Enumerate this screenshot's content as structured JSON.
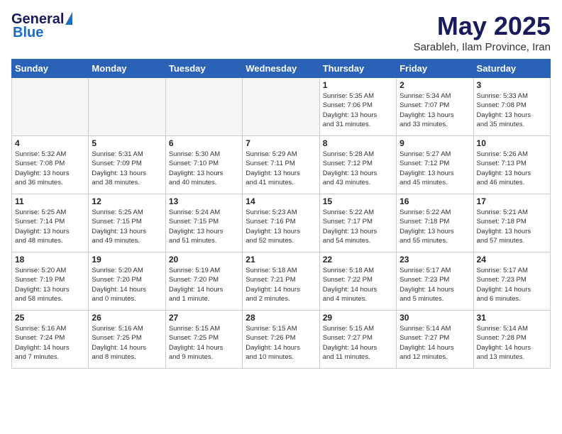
{
  "header": {
    "logo": {
      "general": "General",
      "blue": "Blue"
    },
    "title": "May 2025",
    "location": "Sarableh, Ilam Province, Iran"
  },
  "calendar": {
    "weekdays": [
      "Sunday",
      "Monday",
      "Tuesday",
      "Wednesday",
      "Thursday",
      "Friday",
      "Saturday"
    ],
    "weeks": [
      [
        {
          "day": "",
          "info": ""
        },
        {
          "day": "",
          "info": ""
        },
        {
          "day": "",
          "info": ""
        },
        {
          "day": "",
          "info": ""
        },
        {
          "day": "1",
          "info": "Sunrise: 5:35 AM\nSunset: 7:06 PM\nDaylight: 13 hours\nand 31 minutes."
        },
        {
          "day": "2",
          "info": "Sunrise: 5:34 AM\nSunset: 7:07 PM\nDaylight: 13 hours\nand 33 minutes."
        },
        {
          "day": "3",
          "info": "Sunrise: 5:33 AM\nSunset: 7:08 PM\nDaylight: 13 hours\nand 35 minutes."
        }
      ],
      [
        {
          "day": "4",
          "info": "Sunrise: 5:32 AM\nSunset: 7:08 PM\nDaylight: 13 hours\nand 36 minutes."
        },
        {
          "day": "5",
          "info": "Sunrise: 5:31 AM\nSunset: 7:09 PM\nDaylight: 13 hours\nand 38 minutes."
        },
        {
          "day": "6",
          "info": "Sunrise: 5:30 AM\nSunset: 7:10 PM\nDaylight: 13 hours\nand 40 minutes."
        },
        {
          "day": "7",
          "info": "Sunrise: 5:29 AM\nSunset: 7:11 PM\nDaylight: 13 hours\nand 41 minutes."
        },
        {
          "day": "8",
          "info": "Sunrise: 5:28 AM\nSunset: 7:12 PM\nDaylight: 13 hours\nand 43 minutes."
        },
        {
          "day": "9",
          "info": "Sunrise: 5:27 AM\nSunset: 7:12 PM\nDaylight: 13 hours\nand 45 minutes."
        },
        {
          "day": "10",
          "info": "Sunrise: 5:26 AM\nSunset: 7:13 PM\nDaylight: 13 hours\nand 46 minutes."
        }
      ],
      [
        {
          "day": "11",
          "info": "Sunrise: 5:25 AM\nSunset: 7:14 PM\nDaylight: 13 hours\nand 48 minutes."
        },
        {
          "day": "12",
          "info": "Sunrise: 5:25 AM\nSunset: 7:15 PM\nDaylight: 13 hours\nand 49 minutes."
        },
        {
          "day": "13",
          "info": "Sunrise: 5:24 AM\nSunset: 7:15 PM\nDaylight: 13 hours\nand 51 minutes."
        },
        {
          "day": "14",
          "info": "Sunrise: 5:23 AM\nSunset: 7:16 PM\nDaylight: 13 hours\nand 52 minutes."
        },
        {
          "day": "15",
          "info": "Sunrise: 5:22 AM\nSunset: 7:17 PM\nDaylight: 13 hours\nand 54 minutes."
        },
        {
          "day": "16",
          "info": "Sunrise: 5:22 AM\nSunset: 7:18 PM\nDaylight: 13 hours\nand 55 minutes."
        },
        {
          "day": "17",
          "info": "Sunrise: 5:21 AM\nSunset: 7:18 PM\nDaylight: 13 hours\nand 57 minutes."
        }
      ],
      [
        {
          "day": "18",
          "info": "Sunrise: 5:20 AM\nSunset: 7:19 PM\nDaylight: 13 hours\nand 58 minutes."
        },
        {
          "day": "19",
          "info": "Sunrise: 5:20 AM\nSunset: 7:20 PM\nDaylight: 14 hours\nand 0 minutes."
        },
        {
          "day": "20",
          "info": "Sunrise: 5:19 AM\nSunset: 7:20 PM\nDaylight: 14 hours\nand 1 minute."
        },
        {
          "day": "21",
          "info": "Sunrise: 5:18 AM\nSunset: 7:21 PM\nDaylight: 14 hours\nand 2 minutes."
        },
        {
          "day": "22",
          "info": "Sunrise: 5:18 AM\nSunset: 7:22 PM\nDaylight: 14 hours\nand 4 minutes."
        },
        {
          "day": "23",
          "info": "Sunrise: 5:17 AM\nSunset: 7:23 PM\nDaylight: 14 hours\nand 5 minutes."
        },
        {
          "day": "24",
          "info": "Sunrise: 5:17 AM\nSunset: 7:23 PM\nDaylight: 14 hours\nand 6 minutes."
        }
      ],
      [
        {
          "day": "25",
          "info": "Sunrise: 5:16 AM\nSunset: 7:24 PM\nDaylight: 14 hours\nand 7 minutes."
        },
        {
          "day": "26",
          "info": "Sunrise: 5:16 AM\nSunset: 7:25 PM\nDaylight: 14 hours\nand 8 minutes."
        },
        {
          "day": "27",
          "info": "Sunrise: 5:15 AM\nSunset: 7:25 PM\nDaylight: 14 hours\nand 9 minutes."
        },
        {
          "day": "28",
          "info": "Sunrise: 5:15 AM\nSunset: 7:26 PM\nDaylight: 14 hours\nand 10 minutes."
        },
        {
          "day": "29",
          "info": "Sunrise: 5:15 AM\nSunset: 7:27 PM\nDaylight: 14 hours\nand 11 minutes."
        },
        {
          "day": "30",
          "info": "Sunrise: 5:14 AM\nSunset: 7:27 PM\nDaylight: 14 hours\nand 12 minutes."
        },
        {
          "day": "31",
          "info": "Sunrise: 5:14 AM\nSunset: 7:28 PM\nDaylight: 14 hours\nand 13 minutes."
        }
      ]
    ]
  }
}
